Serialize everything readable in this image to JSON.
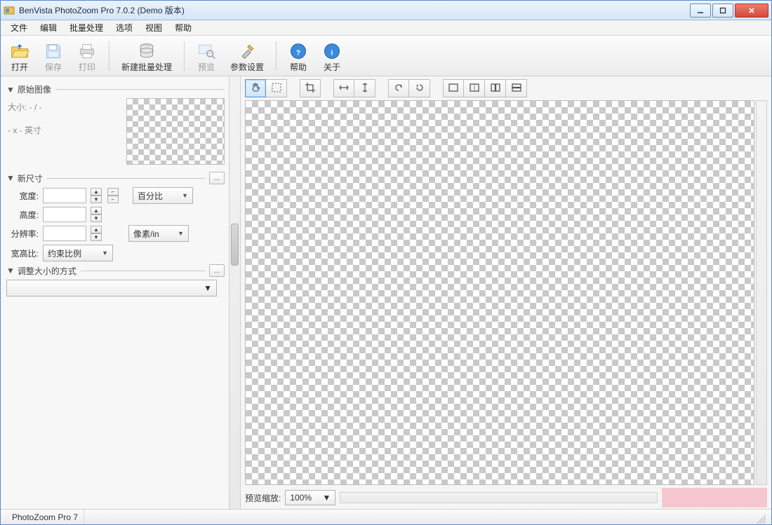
{
  "window": {
    "title": "BenVista PhotoZoom Pro 7.0.2 (Demo 版本)"
  },
  "menu": {
    "items": [
      "文件",
      "编辑",
      "批量处理",
      "选项",
      "视图",
      "帮助"
    ]
  },
  "toolbar": {
    "open": "打开",
    "save": "保存",
    "print": "打印",
    "batch": "新建批量处理",
    "preview": "预览",
    "params": "参数设置",
    "help": "帮助",
    "about": "关于"
  },
  "panel": {
    "original": {
      "title": "原始图像",
      "size_label": "大小: - / -",
      "dims_label": "- x - 英寸"
    },
    "newsize": {
      "title": "新尺寸",
      "width": "宽度:",
      "height": "高度:",
      "res": "分辨率:",
      "ratio": "宽高比:",
      "unit_percent": "百分比",
      "unit_pixels_in": "像素/in",
      "constrain": "约束比例",
      "expand_btn": "..."
    },
    "resize_method": {
      "title": "调整大小的方式",
      "method": "",
      "expand_btn": "..."
    }
  },
  "preview": {
    "zoom_label": "预览缩放:",
    "zoom_value": "100%"
  },
  "status": {
    "product": "PhotoZoom Pro 7"
  }
}
